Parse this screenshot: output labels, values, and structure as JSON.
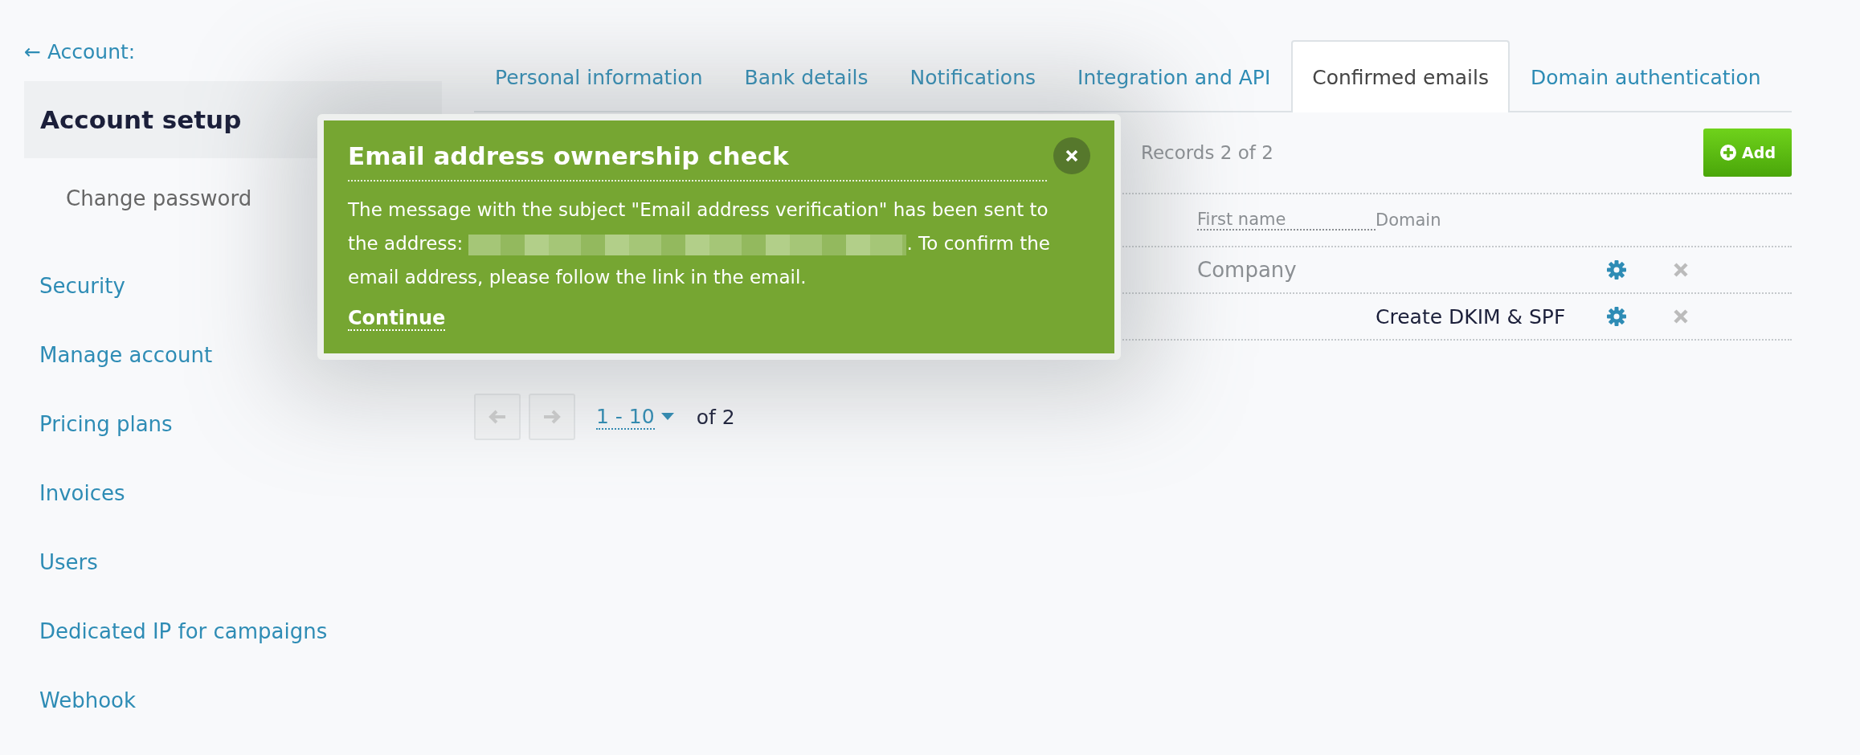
{
  "back_link": "← Account:",
  "sidebar": {
    "items": [
      {
        "label": "Account setup",
        "selected": true,
        "children": [
          {
            "label": "Change password",
            "selected": false
          }
        ]
      },
      {
        "label": "Security",
        "selected": false
      },
      {
        "label": "Manage account",
        "selected": false
      },
      {
        "label": "Pricing plans",
        "selected": false
      },
      {
        "label": "Invoices",
        "selected": false
      },
      {
        "label": "Users",
        "selected": false
      },
      {
        "label": "Dedicated IP for campaigns",
        "selected": false
      },
      {
        "label": "Webhook",
        "selected": false
      }
    ]
  },
  "tabs": [
    {
      "label": "Personal information",
      "selected": false
    },
    {
      "label": "Bank details",
      "selected": false
    },
    {
      "label": "Notifications",
      "selected": false
    },
    {
      "label": "Integration and API",
      "selected": false
    },
    {
      "label": "Confirmed emails",
      "selected": true
    },
    {
      "label": "Domain authentication",
      "selected": false
    }
  ],
  "toolbar": {
    "records": "Records 2 of 2",
    "add_button": "Add"
  },
  "table": {
    "columns": [
      {
        "label": "First name",
        "sortable": true
      },
      {
        "label": "Domain",
        "sortable": false
      }
    ],
    "rows": [
      {
        "first_name": "Company"
      },
      {
        "domain": "Create DKIM & SPF"
      }
    ]
  },
  "pagination": {
    "range": "1 - 10",
    "total": "of 2"
  },
  "modal": {
    "title": "Email address ownership check",
    "message": "The message with the subject \"Email address verification\" has been sent to the address:",
    "message_end": ". To confirm the email address, please follow the link in the email.",
    "action": "Continue"
  }
}
